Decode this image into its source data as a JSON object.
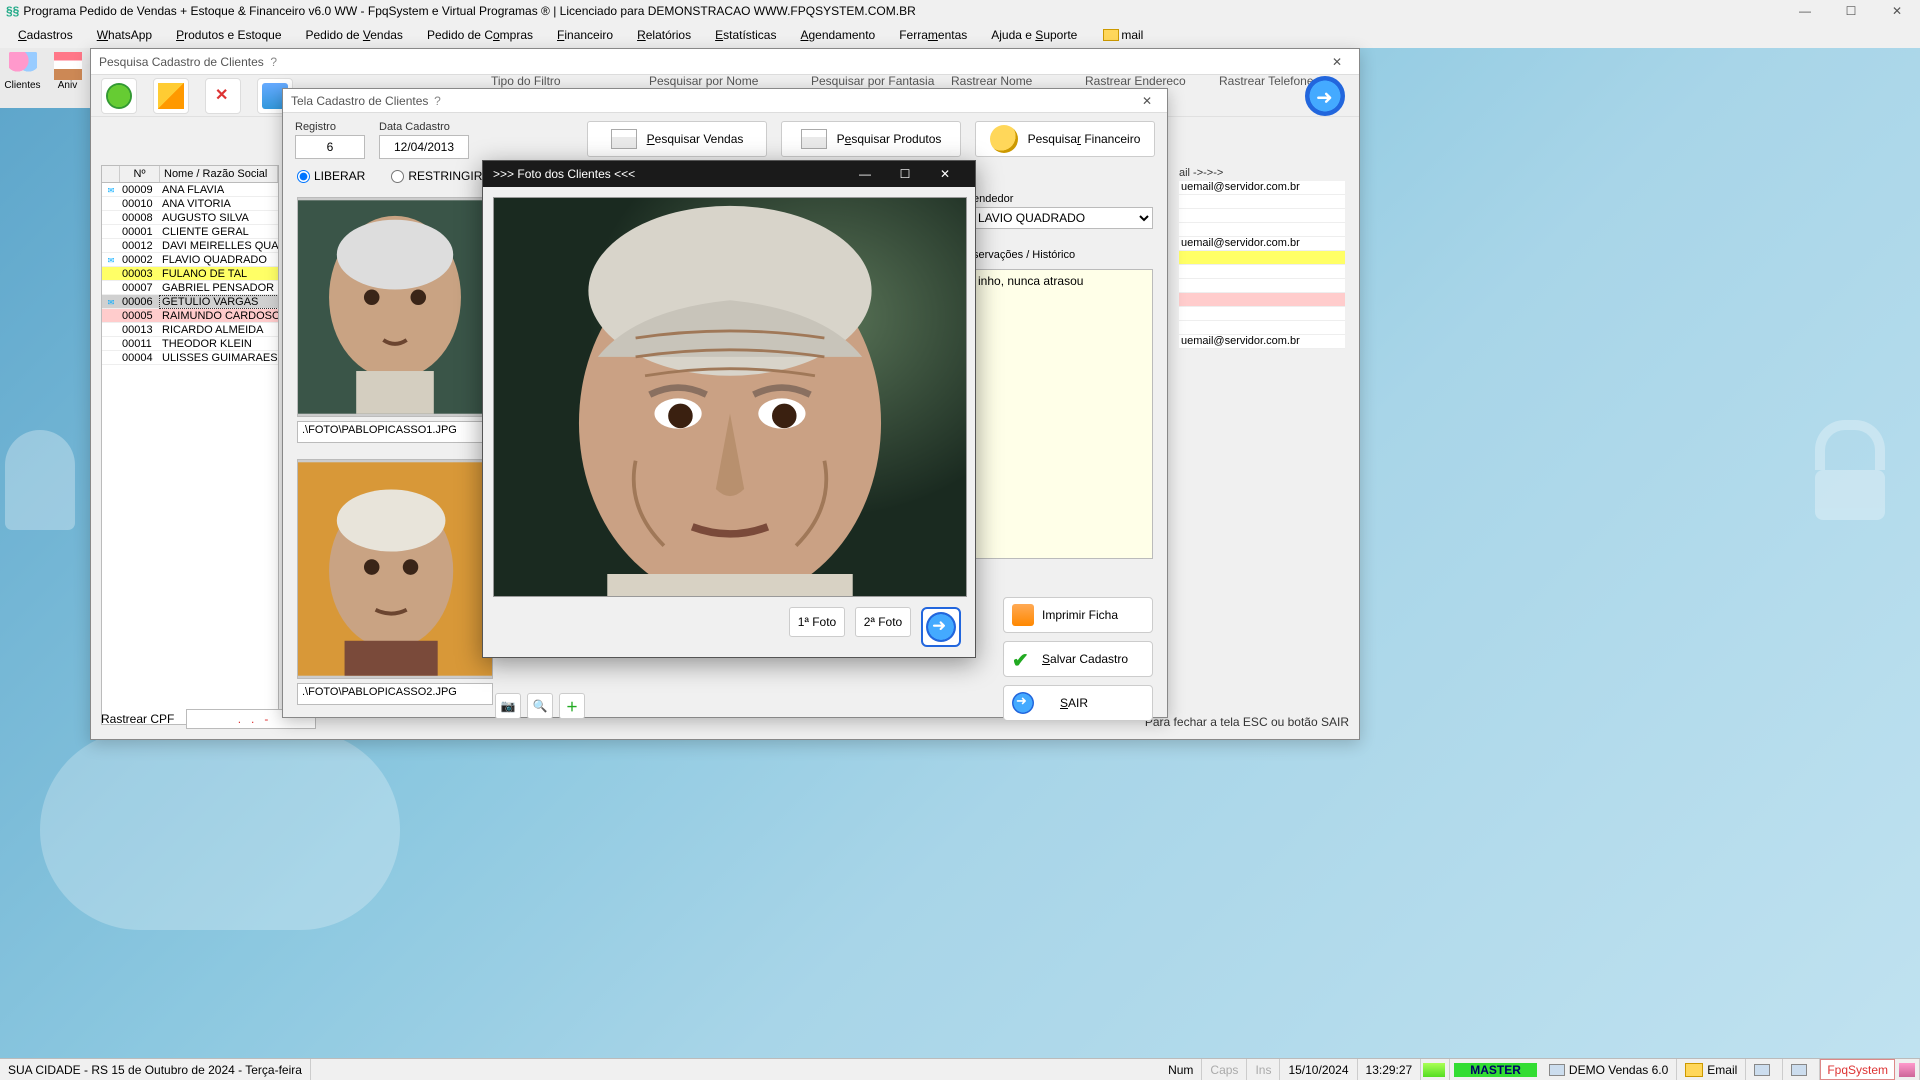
{
  "app": {
    "title": "Programa Pedido de Vendas + Estoque & Financeiro v6.0 WW - FpqSystem e Virtual Programas ® | Licenciado para  DEMONSTRACAO WWW.FPQSYSTEM.COM.BR"
  },
  "menu": {
    "items": [
      "Cadastros",
      "WhatsApp",
      "Produtos e Estoque",
      "Pedido de Vendas",
      "Pedido de Compras",
      "Financeiro",
      "Relatórios",
      "Estatísticas",
      "Agendamento",
      "Ferramentas",
      "Ajuda e Suporte"
    ],
    "mail": "mail"
  },
  "toolbar": {
    "clientes": "Clientes",
    "aniv": "Aniv"
  },
  "search_window": {
    "title": "Pesquisa Cadastro de Clientes",
    "labels": {
      "tipo_filtro": "Tipo do Filtro",
      "pesq_nome": "Pesquisar por Nome",
      "pesq_fantasia": "Pesquisar por Fantasia",
      "rastrear_nome": "Rastrear Nome",
      "rastrear_endereco": "Rastrear Endereco",
      "rastrear_telefone": "Rastrear Telefone"
    },
    "grid_headers": {
      "num": "Nº",
      "nome": "Nome / Razão Social"
    },
    "rows": [
      {
        "env": true,
        "num": "00009",
        "nome": "ANA FLAVIA",
        "cls": ""
      },
      {
        "env": false,
        "num": "00010",
        "nome": "ANA VITORIA",
        "cls": ""
      },
      {
        "env": false,
        "num": "00008",
        "nome": "AUGUSTO SILVA",
        "cls": ""
      },
      {
        "env": false,
        "num": "00001",
        "nome": "CLIENTE GERAL",
        "cls": ""
      },
      {
        "env": false,
        "num": "00012",
        "nome": "DAVI MEIRELLES QUADR",
        "cls": ""
      },
      {
        "env": true,
        "num": "00002",
        "nome": "FLAVIO QUADRADO",
        "cls": ""
      },
      {
        "env": false,
        "num": "00003",
        "nome": "FULANO DE TAL",
        "cls": "row-yellow"
      },
      {
        "env": false,
        "num": "00007",
        "nome": "GABRIEL PENSADOR",
        "cls": ""
      },
      {
        "env": true,
        "num": "00006",
        "nome": "GETULIO VARGAS",
        "cls": "row-sel"
      },
      {
        "env": false,
        "num": "00005",
        "nome": "RAIMUNDO CARDOSO",
        "cls": "row-pink"
      },
      {
        "env": false,
        "num": "00013",
        "nome": "RICARDO ALMEIDA",
        "cls": ""
      },
      {
        "env": false,
        "num": "00011",
        "nome": "THEODOR KLEIN",
        "cls": ""
      },
      {
        "env": false,
        "num": "00004",
        "nome": "ULISSES GUIMARAES",
        "cls": ""
      }
    ],
    "rastrear_cpf_label": "Rastrear CPF",
    "rastrear_cpf_value": "   .   .   -  ",
    "email_header": "ail ->->->",
    "email_rows": [
      {
        "txt": "uemail@servidor.com.br",
        "cls": ""
      },
      {
        "txt": "",
        "cls": ""
      },
      {
        "txt": "",
        "cls": ""
      },
      {
        "txt": "",
        "cls": ""
      },
      {
        "txt": "uemail@servidor.com.br",
        "cls": ""
      },
      {
        "txt": "",
        "cls": "ry"
      },
      {
        "txt": "",
        "cls": ""
      },
      {
        "txt": "",
        "cls": ""
      },
      {
        "txt": "",
        "cls": "rp"
      },
      {
        "txt": "",
        "cls": ""
      },
      {
        "txt": "",
        "cls": ""
      },
      {
        "txt": "uemail@servidor.com.br",
        "cls": ""
      }
    ],
    "footer_hint": "Para fechar a tela ESC ou botão SAIR"
  },
  "cadastro_window": {
    "title": "Tela Cadastro de Clientes",
    "registro_label": "Registro",
    "registro_value": "6",
    "data_label": "Data Cadastro",
    "data_value": "12/04/2013",
    "pesq_vendas": "Pesquisar Vendas",
    "pesq_produtos": "Pesquisar Produtos",
    "pesq_fin": "Pesquisar  Financeiro",
    "liberar": "LIBERAR",
    "restringir": "RESTRINGIR",
    "photo1_path": ".\\FOTO\\PABLOPICASSO1.JPG",
    "photo2_path": ".\\FOTO\\PABLOPICASSO2.JPG",
    "vendedor_label": "endedor",
    "vendedor_value": "LAVIO QUADRADO",
    "obs_label": "servações / Histórico",
    "obs_text": "inho, nunca atrasou",
    "btn_imprimir": "Imprimir Ficha",
    "btn_salvar": "Salvar Cadastro",
    "btn_sair": "SAIR"
  },
  "foto_modal": {
    "title": ">>> Foto dos Clientes <<<",
    "btn1": "1ª Foto",
    "btn2": "2ª Foto"
  },
  "statusbar": {
    "city": "SUA CIDADE - RS 15 de Outubro de 2024 - Terça-feira",
    "num": "Num",
    "caps": "Caps",
    "ins": "Ins",
    "date": "15/10/2024",
    "time": "13:29:27",
    "master": "MASTER",
    "demo": "DEMO Vendas 6.0",
    "email": "Email",
    "brand": "FpqSystem"
  }
}
